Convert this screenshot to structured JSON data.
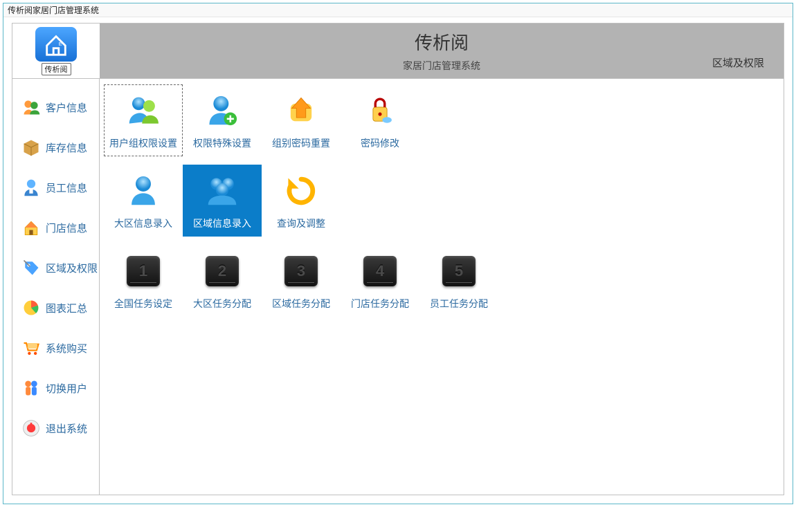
{
  "window_title": "传析阅家居门店管理系统",
  "header": {
    "logo_text": "传析阅",
    "title": "传析阅",
    "subtitle": "家居门店管理系统",
    "section": "区域及权限"
  },
  "sidebar": {
    "items": [
      {
        "icon": "users-icon",
        "label": "客户信息"
      },
      {
        "icon": "box-icon",
        "label": "库存信息"
      },
      {
        "icon": "employee-icon",
        "label": "员工信息"
      },
      {
        "icon": "store-icon",
        "label": "门店信息"
      },
      {
        "icon": "tag-icon",
        "label": "区域及权限"
      },
      {
        "icon": "chart-icon",
        "label": "图表汇总"
      },
      {
        "icon": "cart-icon",
        "label": "系统购买"
      },
      {
        "icon": "switch-user-icon",
        "label": "切换用户"
      },
      {
        "icon": "exit-icon",
        "label": "退出系统"
      }
    ]
  },
  "main": {
    "rows": [
      [
        {
          "icon": "group-perm-icon",
          "label": "用户组权限设置",
          "state": "focused"
        },
        {
          "icon": "user-add-icon",
          "label": "权限特殊设置"
        },
        {
          "icon": "arrow-up-icon",
          "label": "组别密码重置"
        },
        {
          "icon": "lock-icon",
          "label": "密码修改"
        }
      ],
      [
        {
          "icon": "person-icon",
          "label": "大区信息录入"
        },
        {
          "icon": "group-icon",
          "label": "区域信息录入",
          "state": "selected"
        },
        {
          "icon": "refresh-icon",
          "label": "查询及调整"
        }
      ],
      [
        {
          "icon": "hdd",
          "num": "1",
          "label": "全国任务设定"
        },
        {
          "icon": "hdd",
          "num": "2",
          "label": "大区任务分配"
        },
        {
          "icon": "hdd",
          "num": "3",
          "label": "区域任务分配"
        },
        {
          "icon": "hdd",
          "num": "4",
          "label": "门店任务分配"
        },
        {
          "icon": "hdd",
          "num": "5",
          "label": "员工任务分配"
        }
      ]
    ]
  }
}
